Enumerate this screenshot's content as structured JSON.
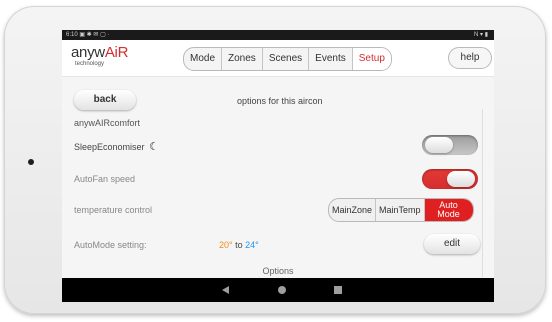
{
  "status_bar": {
    "left": "6:10 ▣ ✱ ✉ ▢ ·",
    "right": "N ▾ ▮"
  },
  "brand": {
    "name_prefix": "anyw",
    "name_accent": "AiR",
    "tagline": "technology"
  },
  "tabs": [
    {
      "label": "Mode",
      "active": false
    },
    {
      "label": "Zones",
      "active": false
    },
    {
      "label": "Scenes",
      "active": false
    },
    {
      "label": "Events",
      "active": false
    },
    {
      "label": "Setup",
      "active": true
    }
  ],
  "help_label": "help",
  "back_label": "back",
  "page_title": "options for this aircon",
  "section_label": "anywAIRcomfort",
  "sleep_economiser": {
    "label": "SleepEconomiser",
    "icon": "moon-icon",
    "on": false
  },
  "autofan_speed": {
    "label": "AutoFan speed",
    "on": true
  },
  "temperature_control": {
    "label": "temperature control",
    "options": [
      "MainZone",
      "MainTemp",
      "Auto Mode"
    ],
    "selected": "Auto Mode"
  },
  "automode_setting": {
    "label": "AutoMode setting:",
    "low": "20°",
    "separator": "to",
    "high": "24°",
    "edit_label": "edit"
  },
  "options_heading": "Options",
  "colors": {
    "accent": "#d32f2f",
    "low_temp": "#f08c1e",
    "high_temp": "#2196f3",
    "nav_bar": "#000000"
  }
}
